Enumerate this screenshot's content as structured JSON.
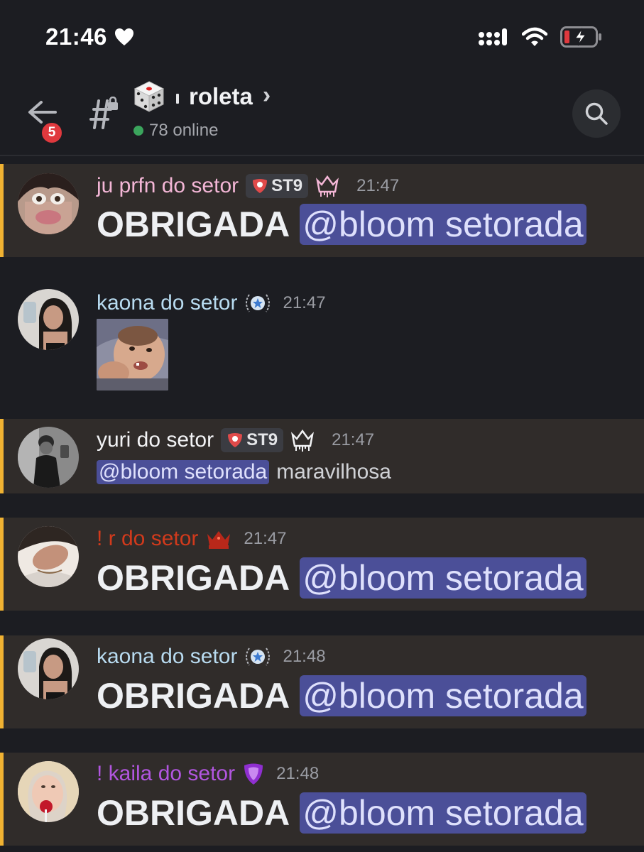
{
  "status_bar": {
    "time": "21:46"
  },
  "header": {
    "back_badge": "5",
    "channel_name": "roleta",
    "online": "78 online",
    "chevron": "›"
  },
  "messages": [
    {
      "author": "ju prfn do setor",
      "tag": "ST9",
      "time": "21:47",
      "text": "OBRIGADA",
      "mention": "@bloom setorada"
    },
    {
      "author": "kaona do setor",
      "time": "21:47"
    },
    {
      "author": "yuri do setor",
      "tag": "ST9",
      "time": "21:47",
      "mention": "@bloom setorada",
      "text": "maravilhosa"
    },
    {
      "author": "! r do setor",
      "time": "21:47",
      "text": "OBRIGADA",
      "mention": "@bloom setorada"
    },
    {
      "author": "kaona do setor",
      "time": "21:48",
      "text": "OBRIGADA",
      "mention": "@bloom setorada"
    },
    {
      "author": "! kaila do setor",
      "time": "21:48",
      "text": "OBRIGADA",
      "mention": "@bloom setorada"
    }
  ],
  "colors": {
    "background": "#1c1d22",
    "highlight": "#302c2a",
    "highlight_bar": "#f0b232",
    "mention_bg": "#4b4f98",
    "name_pink": "#f3b6d6",
    "name_blue": "#b8dbf0",
    "name_white": "#f2f3f5",
    "name_red": "#d13a1c",
    "name_purple": "#b256e0",
    "online_green": "#3ba55d"
  }
}
